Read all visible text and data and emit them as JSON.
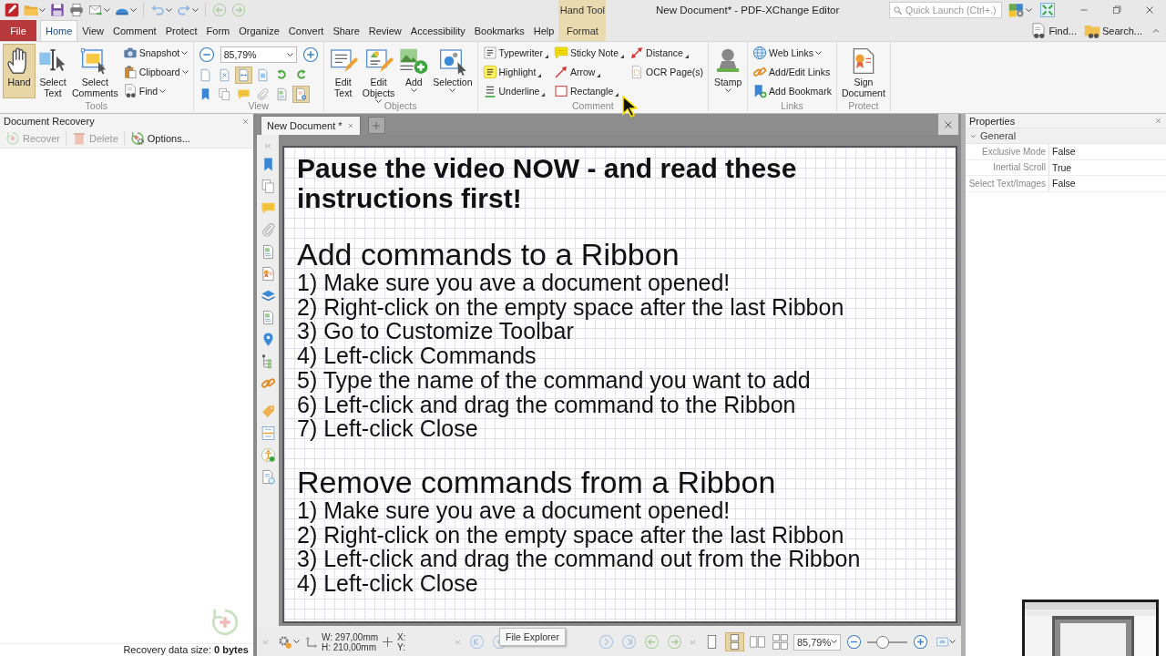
{
  "window": {
    "title": "New Document* - PDF-XChange Editor"
  },
  "contextual": {
    "group": "Hand Tool",
    "tabs": [
      {
        "label": "Format",
        "selected": false
      }
    ]
  },
  "menu_tabs": [
    {
      "label": "File",
      "kind": "file",
      "selected": false
    },
    {
      "label": "Home",
      "kind": "tab",
      "selected": true
    },
    {
      "label": "View",
      "kind": "tab",
      "selected": false
    },
    {
      "label": "Comment",
      "kind": "tab",
      "selected": false
    },
    {
      "label": "Protect",
      "kind": "tab",
      "selected": false
    },
    {
      "label": "Form",
      "kind": "tab",
      "selected": false
    },
    {
      "label": "Organize",
      "kind": "tab",
      "selected": false
    },
    {
      "label": "Convert",
      "kind": "tab",
      "selected": false
    },
    {
      "label": "Share",
      "kind": "tab",
      "selected": false
    },
    {
      "label": "Review",
      "kind": "tab",
      "selected": false
    },
    {
      "label": "Accessibility",
      "kind": "tab",
      "selected": false
    },
    {
      "label": "Bookmarks",
      "kind": "tab",
      "selected": false
    },
    {
      "label": "Help",
      "kind": "tab",
      "selected": false
    }
  ],
  "quick_launch": {
    "placeholder": "Quick Launch (Ctrl+.)"
  },
  "header_buttons": [
    "Find...",
    "Search..."
  ],
  "ribbon": [
    {
      "title": "Tools",
      "kind": "buttons",
      "buttons": [
        {
          "kind": "large",
          "label": "Hand",
          "selected": true
        },
        {
          "kind": "large",
          "label": "Select Text",
          "selected": false
        },
        {
          "kind": "large",
          "label": "Select Comments",
          "selected": false
        },
        {
          "kind": "small",
          "label": "Snapshot",
          "dropdown": true,
          "selected": false
        },
        {
          "kind": "small",
          "label": "Clipboard",
          "dropdown": true,
          "selected": false
        },
        {
          "kind": "small",
          "label": "Find",
          "dropdown": true,
          "selected": false
        }
      ]
    },
    {
      "title": "View",
      "kind": "view",
      "zoom": "85,79%",
      "buttons": [
        {
          "selected": false
        },
        {
          "selected": false
        },
        {
          "selected": true
        },
        {
          "selected": false
        },
        {
          "selected": false
        },
        {
          "selected": false
        },
        {
          "selected": false
        },
        {
          "selected": false
        },
        {
          "selected": false
        },
        {
          "selected": false
        },
        {
          "selected": false
        },
        {
          "selected": true
        }
      ]
    },
    {
      "title": "Objects",
      "kind": "buttons",
      "buttons": [
        {
          "kind": "large",
          "label": "Edit Text"
        },
        {
          "kind": "large",
          "label": "Edit Objects",
          "dropdown": true
        },
        {
          "kind": "large",
          "label": "Add",
          "dropdown": true
        },
        {
          "kind": "large",
          "label": "Selection",
          "dropdown": true
        }
      ]
    },
    {
      "title": "Comment",
      "kind": "annotation-tools",
      "buttons": [
        {
          "kind": "small",
          "label": "Typewriter",
          "dropdown": true
        },
        {
          "kind": "small",
          "label": "Highlight",
          "dropdown": true
        },
        {
          "kind": "small",
          "label": "Underline",
          "dropdown": true
        },
        {
          "kind": "small",
          "label": "Sticky Note",
          "dropdown": true
        },
        {
          "kind": "small",
          "label": "Arrow",
          "dropdown": true
        },
        {
          "kind": "small",
          "label": "Rectangle",
          "dropdown": true
        },
        {
          "kind": "small",
          "label": "Distance",
          "dropdown": true
        },
        {
          "kind": "small",
          "label": "OCR Page(s)"
        }
      ]
    },
    {
      "kind": "buttons",
      "buttons": [
        {
          "kind": "large",
          "label": "Stamp",
          "dropdown": true
        }
      ]
    },
    {
      "title": "Links",
      "kind": "buttons",
      "buttons": [
        {
          "kind": "small",
          "label": "Web Links",
          "dropdown": true
        },
        {
          "kind": "small",
          "label": "Add/Edit Links"
        },
        {
          "kind": "small",
          "label": "Add Bookmark"
        }
      ]
    },
    {
      "title": "Protect",
      "kind": "buttons",
      "buttons": [
        {
          "kind": "large",
          "label": "Sign Document"
        }
      ]
    }
  ],
  "recovery_panel": {
    "title": "Document Recovery",
    "toolbar": [
      {
        "label": "Recover",
        "disabled": true
      },
      {
        "label": "Delete",
        "disabled": true
      },
      {
        "label": "Options...",
        "disabled": false
      }
    ],
    "footer": "Recovery data size: **0 bytes**"
  },
  "document_tabs": [
    {
      "label": "New Document *",
      "selected": true
    }
  ],
  "document": {
    "blocks": [
      {
        "kind": "title",
        "text": "Pause the video NOW - and read these instructions first!"
      },
      {
        "kind": "heading",
        "text": "Add commands to a Ribbon"
      },
      {
        "kind": "step",
        "text": "1) Make sure you ave a document opened!"
      },
      {
        "kind": "step",
        "text": "2) Right-click on the empty space after the last Ribbon"
      },
      {
        "kind": "step",
        "text": "3) Go to Customize Toolbar"
      },
      {
        "kind": "step",
        "text": "4) Left-click Commands"
      },
      {
        "kind": "step",
        "text": "5) Type the name of the command you want to add"
      },
      {
        "kind": "step",
        "text": "6) Left-click and drag the command to the Ribbon"
      },
      {
        "kind": "step",
        "text": "7) Left-click Close"
      },
      {
        "kind": "heading",
        "text": "Remove commands from a Ribbon"
      },
      {
        "kind": "step",
        "text": "1) Make sure you ave a document opened!"
      },
      {
        "kind": "step",
        "text": "2) Right-click on the empty space after the last Ribbon"
      },
      {
        "kind": "step",
        "text": "3) Left-click and drag the command out from the Ribbon"
      },
      {
        "kind": "step",
        "text": "4) Left-click Close"
      }
    ]
  },
  "status_bar": {
    "width": "W: 297,00mm",
    "height": "H: 210,00mm",
    "x": "X:",
    "y": "Y:",
    "zoom": "85,79%",
    "zoom_slider": {
      "level": 0.38
    },
    "page_layouts": [
      {
        "selected": false
      },
      {
        "selected": true
      },
      {
        "selected": false
      },
      {
        "selected": false
      }
    ]
  },
  "tooltip": "File Explorer",
  "properties": {
    "title": "Properties",
    "sections": [
      {
        "title": "General",
        "expanded": true,
        "rows": [
          {
            "label": "Exclusive Mode",
            "value": "False"
          },
          {
            "label": "Inertial Scroll",
            "value": "True"
          },
          {
            "label": "Select Text/Images",
            "value": "False"
          }
        ]
      }
    ]
  },
  "video_thumbnail": {
    "kind": "picture"
  }
}
